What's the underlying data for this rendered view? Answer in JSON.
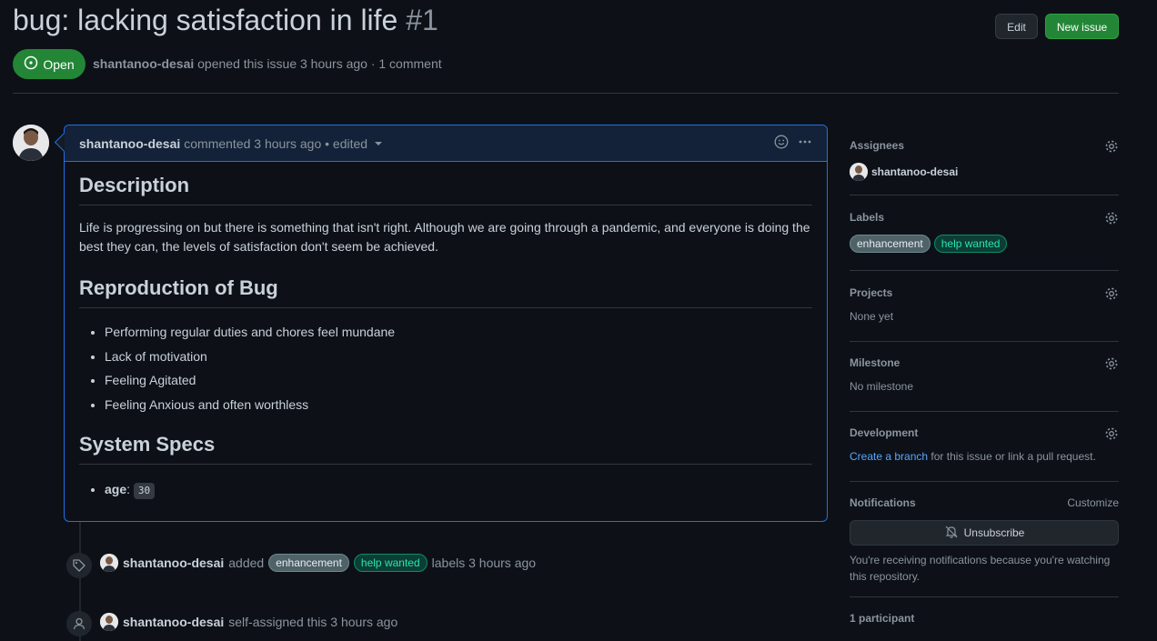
{
  "issue": {
    "title": "bug: lacking satisfaction in life",
    "number": "#1",
    "state": "Open",
    "author": "shantanoo-desai",
    "meta_text": "opened this issue 3 hours ago · 1 comment"
  },
  "buttons": {
    "edit": "Edit",
    "new_issue": "New issue"
  },
  "comment": {
    "author": "shantanoo-desai",
    "meta": "commented 3 hours ago • edited",
    "h1": "Description",
    "p1": "Life is progressing on but there is something that isn't right. Although we are going through a pandemic, and everyone is doing the",
    "p2": "best they can, the levels of satisfaction don't seem be achieved.",
    "h2": "Reproduction of Bug",
    "bullets": [
      "Performing regular duties and chores feel mundane",
      "Lack of motivation",
      "Feeling Agitated",
      "Feeling Anxious and often worthless"
    ],
    "h3": "System Specs",
    "spec_key": "age",
    "spec_colon": ":",
    "spec_value": "30"
  },
  "timeline": [
    {
      "author": "shantanoo-desai",
      "action": "added",
      "label1": "enhancement",
      "label2": "help wanted",
      "suffix": "labels 3 hours ago"
    },
    {
      "author": "shantanoo-desai",
      "action": "self-assigned this 3 hours ago"
    }
  ],
  "sidebar": {
    "assignees": {
      "heading": "Assignees",
      "user": "shantanoo-desai"
    },
    "labels": {
      "heading": "Labels",
      "items": [
        "enhancement",
        "help wanted"
      ]
    },
    "projects": {
      "heading": "Projects",
      "value": "None yet"
    },
    "milestone": {
      "heading": "Milestone",
      "value": "No milestone"
    },
    "development": {
      "heading": "Development",
      "link": "Create a branch",
      "text": "for this issue or link a pull request."
    },
    "notifications": {
      "heading": "Notifications",
      "customize": "Customize",
      "button": "Unsubscribe",
      "text1": "You're receiving notifications because you're watching",
      "text2": "this repository."
    },
    "participants": {
      "heading": "1 participant"
    }
  },
  "colors": {
    "bg": "#0d1117",
    "accent_green": "#238636",
    "accent_blue": "#1f6feb",
    "link": "#58a6ff"
  },
  "icons": [
    "issue-opened-icon",
    "smiley-icon",
    "kebab-horizontal-icon",
    "tag-icon",
    "person-icon",
    "gear-icon",
    "bell-slash-icon"
  ]
}
